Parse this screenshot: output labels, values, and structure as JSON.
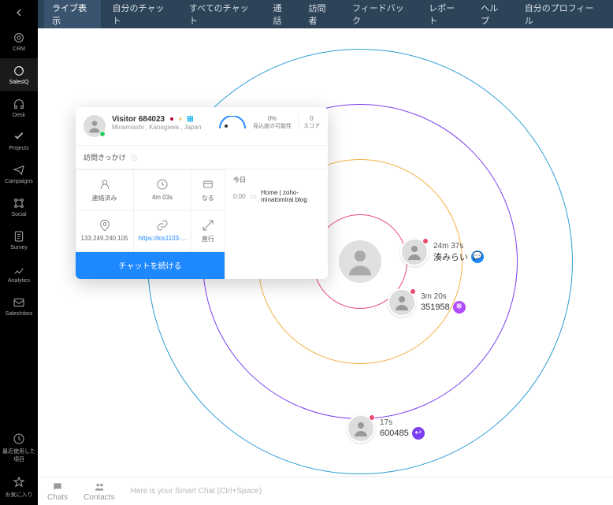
{
  "sidebar": {
    "items": [
      {
        "label": "CRM"
      },
      {
        "label": "SalesIQ"
      },
      {
        "label": "Desk"
      },
      {
        "label": "Projects"
      },
      {
        "label": "Campaigns"
      },
      {
        "label": "Social"
      },
      {
        "label": "Survey"
      },
      {
        "label": "Analytics"
      },
      {
        "label": "SalesInbox"
      }
    ],
    "recent": "最近使用した項目",
    "favorites": "お気に入り"
  },
  "topnav": {
    "items": [
      "ライブ表示",
      "自分のチャット",
      "すべてのチャット",
      "通話",
      "訪問者",
      "フィードバック",
      "レポート",
      "ヘルプ",
      "自分のプロフィール"
    ]
  },
  "visitors": {
    "v1": {
      "time": "24m 37s",
      "name": "湊みらい"
    },
    "v2": {
      "time": "3m 20s",
      "name": "351958"
    },
    "v3": {
      "time": "17s",
      "name": "600485"
    }
  },
  "popup": {
    "visitor_id": "Visitor 684023",
    "location": "Minamiashi , Kanagawa , Japan",
    "section_label": "訪問きっかけ",
    "gauge_percent": "0%",
    "gauge_label": "見込度の可能性",
    "score": "0",
    "score_label": "スコア",
    "today_label": "今日",
    "time_marker": "0:00",
    "page_title": "Home | zoho-minatomirai.blog",
    "grid": {
      "status": "連絡済み",
      "duration": "4m 03s",
      "country": "なる",
      "ip": "133.249.240.105",
      "url": "https://los1103-...",
      "exit": "直行"
    },
    "button": "チャットを続ける"
  },
  "bottombar": {
    "chats": "Chats",
    "contacts": "Contacts",
    "smart_chat": "Here is your Smart Chat (Ctrl+Space)"
  }
}
